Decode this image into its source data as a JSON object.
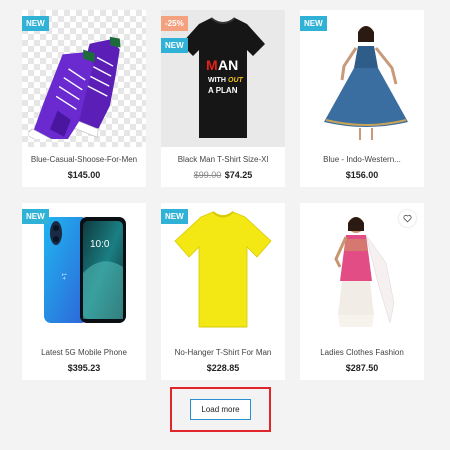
{
  "products": [
    {
      "title": "Blue-Casual-Shoose-For-Men",
      "price": "$145.00",
      "old_price": null,
      "badges": [
        "NEW"
      ],
      "image": "purple-sneakers"
    },
    {
      "title": "Black Man T-Shirt Size-Xl",
      "price": "$74.25",
      "old_price": "$99.00",
      "badges": [
        "-25%",
        "NEW"
      ],
      "image": "black-tshirt"
    },
    {
      "title": "Blue - Indo-Western...",
      "price": "$156.00",
      "old_price": null,
      "badges": [
        "NEW"
      ],
      "image": "blue-dress-model"
    },
    {
      "title": "Latest 5G Mobile Phone",
      "price": "$395.23",
      "old_price": null,
      "badges": [
        "NEW"
      ],
      "image": "blue-smartphone"
    },
    {
      "title": "No-Hanger T-Shirt For Man",
      "price": "$228.85",
      "old_price": null,
      "badges": [
        "NEW"
      ],
      "image": "yellow-tshirt"
    },
    {
      "title": "Ladies Clothes Fashion",
      "price": "$287.50",
      "old_price": null,
      "badges": [],
      "image": "pink-salwar-model",
      "wishlist_icon": "heart-icon"
    }
  ],
  "tshirt_print": {
    "line1_a": "M",
    "line1_b": "AN",
    "line2_a": "WITH",
    "line2_b": "OUT",
    "line3": "A PLAN"
  },
  "load_more": {
    "label": "Load more"
  },
  "colors": {
    "new_badge": "#2fb2d6",
    "sale_badge": "#f4a17f",
    "highlight_box": "#e0262a",
    "button_border": "#2a8fd0"
  }
}
